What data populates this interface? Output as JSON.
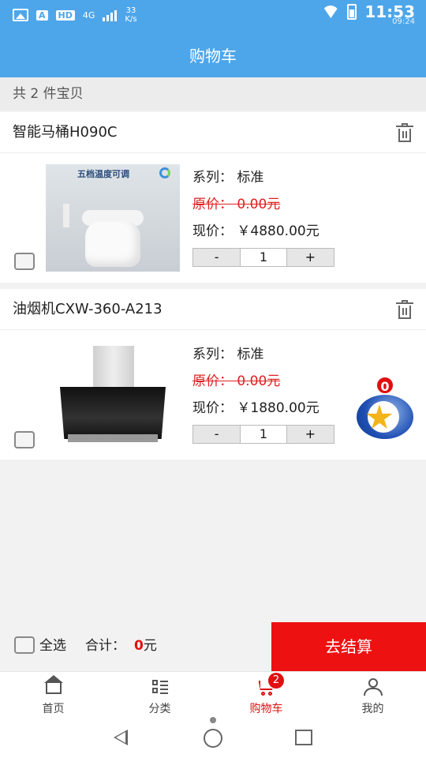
{
  "status_bar": {
    "badge": "A",
    "net_type": "HD",
    "signal": "4G",
    "speed_value": "33",
    "speed_unit": "K/s",
    "time": "11:53",
    "time_sub": "09:24"
  },
  "header": {
    "title": "购物车"
  },
  "cart_count_text": "共 2 件宝贝",
  "items": [
    {
      "title": "智能马桶H090C",
      "series_label": "系列：",
      "series_value": "标准",
      "orig_price": "原价：  0.00元",
      "cur_price_label": "现价：",
      "cur_price_value": "￥4880.00元",
      "minus": "-",
      "qty": "1",
      "plus": "+",
      "image_banner": "五档温度可调"
    },
    {
      "title": "油烟机CXW-360-A213",
      "series_label": "系列：",
      "series_value": "标准",
      "orig_price": "原价：  0.00元",
      "cur_price_label": "现价：",
      "cur_price_value": "￥1880.00元",
      "minus": "-",
      "qty": "1",
      "plus": "+"
    }
  ],
  "float_badge": {
    "count": "0"
  },
  "checkout": {
    "select_all": "全选",
    "total_label": "合计：",
    "total_value": "0",
    "total_unit": "元",
    "pay_button": "去结算"
  },
  "tabs": [
    {
      "label": "首页",
      "icon": "home-icon"
    },
    {
      "label": "分类",
      "icon": "category-icon"
    },
    {
      "label": "购物车",
      "icon": "cart-icon",
      "badge": "2",
      "active": true
    },
    {
      "label": "我的",
      "icon": "user-icon"
    }
  ],
  "colors": {
    "header": "#4ea6ea",
    "accent": "#ee1111"
  }
}
